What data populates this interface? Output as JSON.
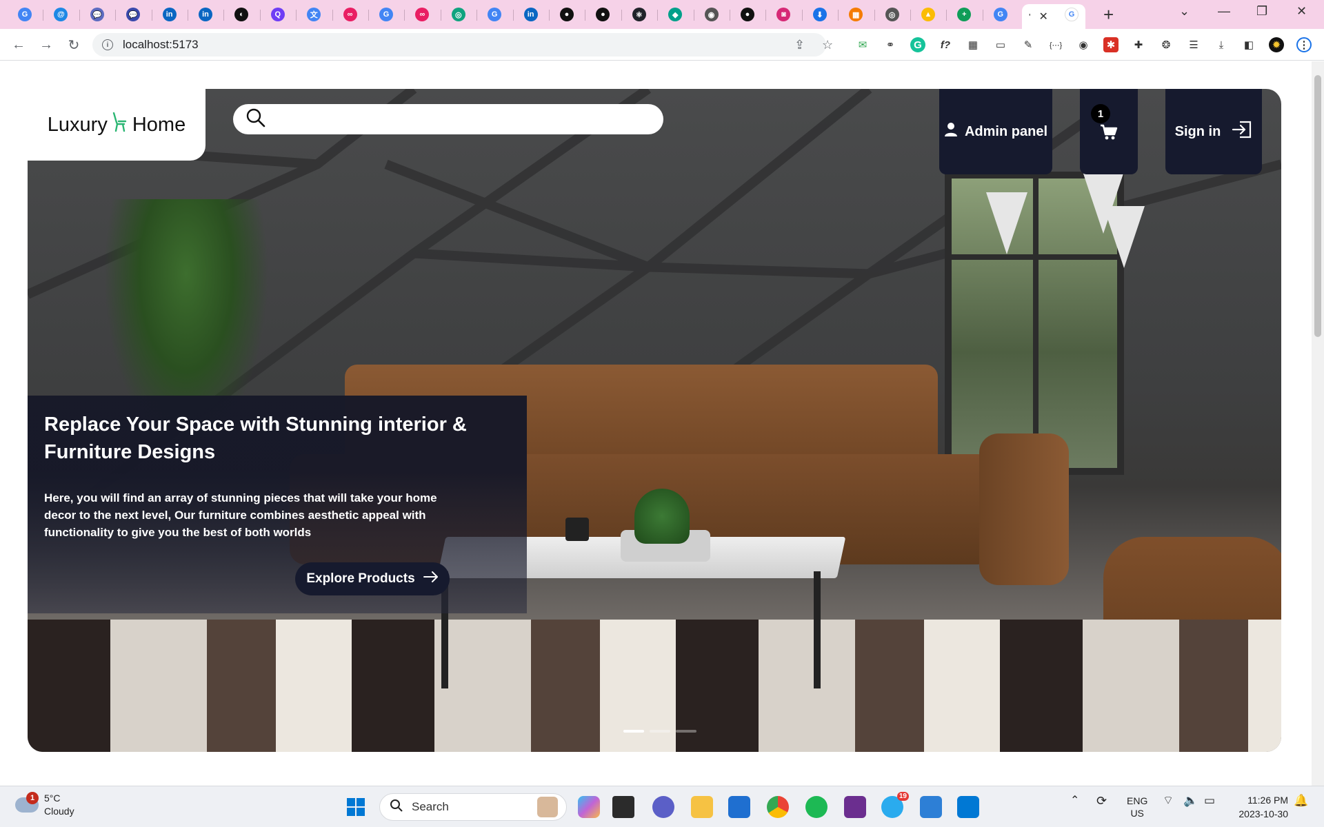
{
  "browser": {
    "tabs": [
      {
        "icon": "G",
        "color": "#4285f4"
      },
      {
        "icon": "@",
        "color": "#1e88e5"
      },
      {
        "icon": "💬",
        "color": "#5c6bc0"
      },
      {
        "icon": "💬",
        "color": "#3949ab"
      },
      {
        "icon": "in",
        "color": "#0a66c2"
      },
      {
        "icon": "in",
        "color": "#0a66c2"
      },
      {
        "icon": "◐",
        "color": "#111111"
      },
      {
        "icon": "Q",
        "color": "#6e3df5"
      },
      {
        "icon": "文",
        "color": "#4285f4"
      },
      {
        "icon": "∞",
        "color": "#e91e63"
      },
      {
        "icon": "G",
        "color": "#4285f4"
      },
      {
        "icon": "∞",
        "color": "#e91e63"
      },
      {
        "icon": "◎",
        "color": "#10a37f"
      },
      {
        "icon": "G",
        "color": "#4285f4"
      },
      {
        "icon": "in",
        "color": "#0a66c2"
      },
      {
        "icon": "●",
        "color": "#111111"
      },
      {
        "icon": "●",
        "color": "#111111"
      },
      {
        "icon": "⚛",
        "color": "#20232a"
      },
      {
        "icon": "◆",
        "color": "#00a08a"
      },
      {
        "icon": "◉",
        "color": "#555555"
      },
      {
        "icon": "●",
        "color": "#111111"
      },
      {
        "icon": "◙",
        "color": "#d62976"
      },
      {
        "icon": "⬇",
        "color": "#1a73e8"
      },
      {
        "icon": "▦",
        "color": "#f57c00"
      },
      {
        "icon": "◎",
        "color": "#555555"
      },
      {
        "icon": "▲",
        "color": "#fbbc04"
      },
      {
        "icon": "+",
        "color": "#0f9d58"
      },
      {
        "icon": "G",
        "color": "#4285f4"
      }
    ],
    "active_tab_label": "'",
    "last_tab_icon": "G",
    "new_tab": "+",
    "url": "localhost:5173",
    "controls": {
      "minimize": "—",
      "restore": "❐",
      "close": "✕",
      "tab_search": "⌄"
    }
  },
  "site": {
    "logo_left": "Luxury",
    "logo_right": "Home",
    "search_placeholder": "",
    "nav": {
      "admin_label": "Admin panel",
      "cart_count": "1",
      "sign_in_label": "Sign in"
    },
    "hero": {
      "title": "Replace Your Space with Stunning interior & Furniture Designs",
      "description": "Here, you will find an array of stunning pieces that will take your home decor to the next level, Our furniture combines aesthetic appeal with functionality to give you the best of both worlds",
      "cta_label": "Explore Products",
      "slide_index": 1,
      "slide_count": 3
    }
  },
  "taskbar": {
    "weather_temp": "5°C",
    "weather_desc": "Cloudy",
    "weather_badge": "1",
    "search_label": "Search",
    "telegram_badge": "19",
    "language_top": "ENG",
    "language_bottom": "US",
    "time": "11:26 PM",
    "date": "2023-10-30"
  }
}
